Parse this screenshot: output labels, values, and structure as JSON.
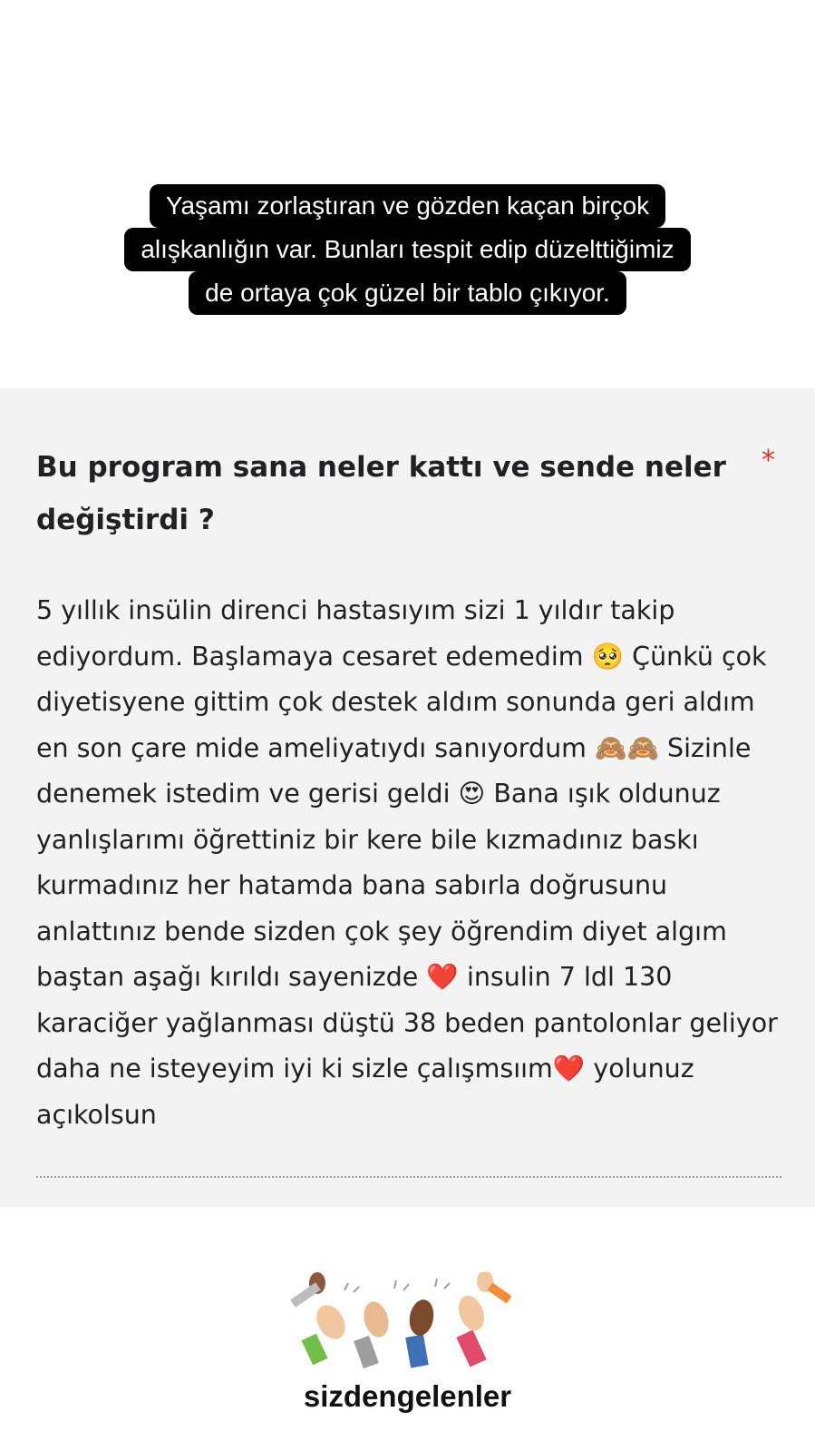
{
  "caption": {
    "lines": [
      "Yaşamı zorlaştıran ve gözden kaçan birçok",
      "alışkanlığın var. Bunları tespit edip düzelttiğimiz",
      "de ortaya çok güzel bir tablo çıkıyor."
    ]
  },
  "form": {
    "question": "Bu program sana neler kattı ve sende neler değiştirdi ?",
    "required_mark": "*",
    "answer": "5 yıllık insülin direnci hastasıyım sizi 1 yıldır takip ediyordum. Başlamaya cesaret edemedim 🥺 Çünkü çok diyetisyene gittim çok destek aldım sonunda geri aldım en son çare mide ameliyatıydı sanıyordum 🙈🙈 Sizinle denemek istedim ve gerisi geldi 😍 Bana ışık oldunuz yanlışlarımı öğrettiniz bir kere bile kızmadınız baskı kurmadınız her hatamda bana sabırla doğrusunu anlattınız bende sizden çok şey öğrendim diyet algım baştan aşağı kırıldı sayenizde ❤️ insulin 7 ldl 130 karaciğer yağlanması düştü 38 beden pantolonlar geliyor daha ne isteyeyim iyi ki sizle çalışmsıım❤️ yolunuz açıkolsun"
  },
  "footer": {
    "brand": "sizdengelenler",
    "icon": "clapping-hands-icon",
    "colors": [
      "#6fbf4a",
      "#9e9e9e",
      "#3f6fb5",
      "#e24a6a",
      "#f28c38"
    ]
  }
}
